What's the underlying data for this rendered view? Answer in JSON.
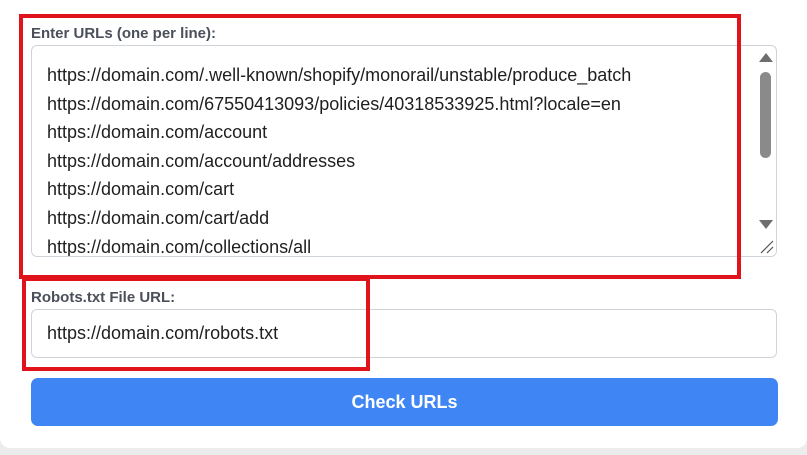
{
  "form": {
    "urls_label": "Enter URLs (one per line):",
    "urls": [
      "https://domain.com/.well-known/shopify/monorail/unstable/produce_batch",
      "https://domain.com/67550413093/policies/40318533925.html?locale=en",
      "https://domain.com/account",
      "https://domain.com/account/addresses",
      "https://domain.com/cart",
      "https://domain.com/cart/add",
      "https://domain.com/collections/all"
    ],
    "robots_label": "Robots.txt File URL:",
    "robots_value": "https://domain.com/robots.txt",
    "check_button_label": "Check URLs"
  },
  "colors": {
    "accent": "#3f86f4",
    "highlight": "#e0121b"
  }
}
